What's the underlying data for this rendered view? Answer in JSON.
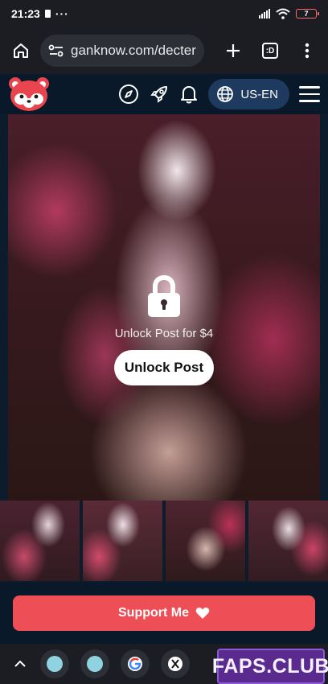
{
  "status_bar": {
    "time": "21:23",
    "overflow": "···",
    "battery": "7"
  },
  "browser": {
    "url": "ganknow.com/decter",
    "tab_count": ":D"
  },
  "site_header": {
    "language": "US-EN"
  },
  "post": {
    "unlock_text": "Unlock Post for $4",
    "unlock_button": "Unlock Post"
  },
  "support": {
    "label": "Support Me"
  },
  "watermark": {
    "text": "FAPS.CLUB"
  },
  "colors": {
    "brand_red": "#ee4e55",
    "lang_pill": "#1f3a5f",
    "header_bg": "#0a1929"
  },
  "icons": {
    "header": [
      "compass-icon",
      "rocket-icon",
      "bell-icon",
      "globe-icon",
      "menu-icon"
    ],
    "browser": [
      "home-icon",
      "site-settings-icon",
      "new-tab-icon",
      "tab-switcher-icon",
      "more-options-icon"
    ]
  }
}
